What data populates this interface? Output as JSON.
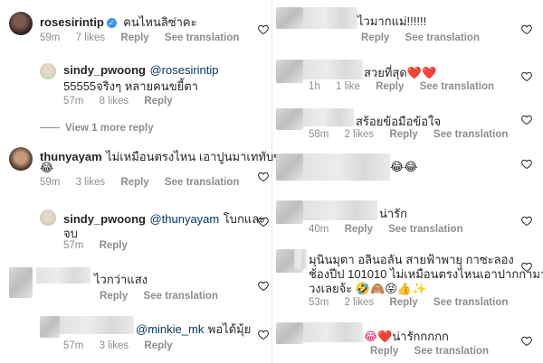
{
  "icons": {
    "heart": "heart-outline-icon",
    "verified": "verified-badge-icon"
  },
  "common": {
    "reply": "Reply",
    "see_translation": "See translation"
  },
  "left": {
    "c1": {
      "username": "rosesirintip",
      "text": "คนไหนลิซ่าคะ",
      "time": "59m",
      "likes": "7 likes"
    },
    "c2": {
      "username": "sindy_pwoong",
      "mention": "@rosesirintip",
      "text_line2": "55555จริงๆ หลายคนขยี้ตา",
      "time": "57m",
      "likes": "8 likes"
    },
    "view_more": "View 1 more reply",
    "c3": {
      "username": "thunyayam",
      "text_line1": "ไม่เหมือนตรงไหน เอาปูนมาเททับซะ",
      "text_line2": "😂",
      "time": "59m",
      "likes": "3 likes"
    },
    "c4": {
      "username": "sindy_pwoong",
      "mention": "@thunyayam",
      "text_line1": "โบกและ",
      "text_line2": "จบ",
      "time": "57m"
    },
    "c5": {
      "text": "ไวกว่าแสง"
    },
    "c6": {
      "mention": "@minkie_mk",
      "text": "พอได้มุ้ย",
      "time": "57m",
      "likes": "3 likes"
    }
  },
  "right": {
    "r1": {
      "text": "ไวมากแม่!!!!!!"
    },
    "r2": {
      "text": "สวยที่สุด",
      "emoji": "❤️❤️",
      "time": "1h",
      "likes": "1 like"
    },
    "r3": {
      "text": "สร้อยข้อมือข้อใจ",
      "time": "58m",
      "likes": "2 likes"
    },
    "r4": {
      "text": "😂😂"
    },
    "r5": {
      "text": "น่ารัก",
      "time": "40m"
    },
    "r6": {
      "line1": "มุนินมุตา อลินอลัน สายฟ้าพายุ กาซะลอง",
      "line2": "ช้องปีป 101010 ไม่เหมือนตรงไหนเอาปากกามา",
      "line3": "วงเลยจ้ะ 🤣🙈😝👍✨",
      "time": "53m",
      "likes": "2 likes"
    },
    "r7": {
      "emoji": "😂❤️",
      "text": "น่ารักกกกก"
    }
  }
}
